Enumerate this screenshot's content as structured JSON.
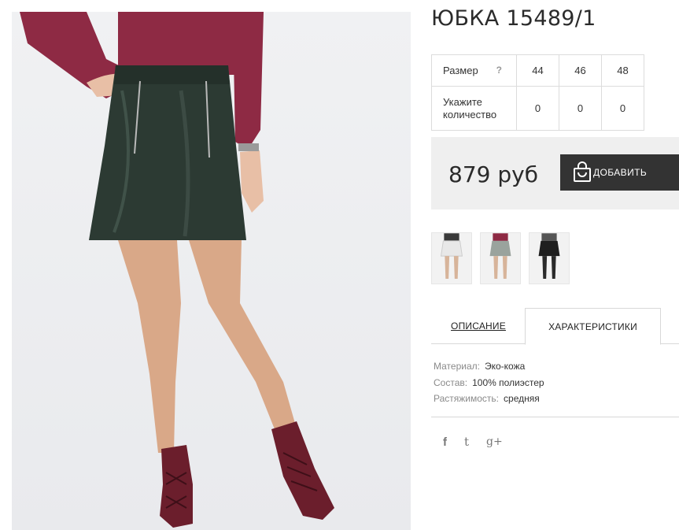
{
  "product": {
    "title": "ЮБКА 15489/1",
    "price": "879 руб",
    "add_to_cart_label": "ДОБАВИТЬ"
  },
  "size_table": {
    "size_label": "Размер",
    "help_mark": "?",
    "quantity_label": "Укажите количество",
    "sizes": [
      "44",
      "46",
      "48"
    ],
    "quantities": [
      "0",
      "0",
      "0"
    ]
  },
  "tabs": {
    "description_label": "ОПИСАНИЕ",
    "characteristics_label": "ХАРАКТЕРИСТИКИ"
  },
  "specs": [
    {
      "key": "Материал:",
      "value": "Эко-кожа"
    },
    {
      "key": "Состав:",
      "value": "100% полиэстер"
    },
    {
      "key": "Растяжимость:",
      "value": "средняя"
    }
  ],
  "social": {
    "facebook": "f",
    "twitter": "t",
    "google_plus": "g+"
  },
  "colors": {
    "button_bg": "#333333",
    "buy_box_bg": "#efefef",
    "skirt": "#2c3a33",
    "top": "#8e2a44",
    "shoes": "#6b1e2c"
  },
  "icons": [
    "shopping-bag-icon",
    "help-icon",
    "facebook-icon",
    "twitter-icon",
    "google-plus-icon"
  ]
}
